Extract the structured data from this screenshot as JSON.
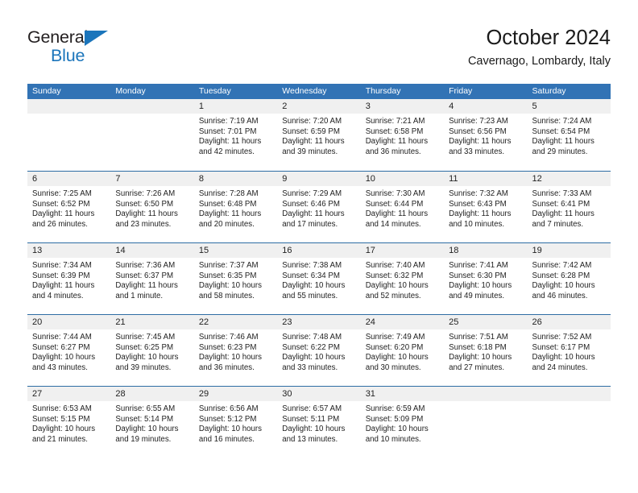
{
  "brand": {
    "name_part1": "General",
    "name_part2": "Blue",
    "color_dark": "#231f20",
    "color_blue": "#1b75bb"
  },
  "header": {
    "title": "October 2024",
    "location": "Cavernago, Lombardy, Italy"
  },
  "theme": {
    "header_blue": "#3273b5",
    "row_separator_blue": "#2e6da4",
    "day_strip_gray": "#f0f0f0",
    "text_color": "#222222"
  },
  "weekdays": [
    "Sunday",
    "Monday",
    "Tuesday",
    "Wednesday",
    "Thursday",
    "Friday",
    "Saturday"
  ],
  "weeks": [
    [
      {
        "day": "",
        "lines": []
      },
      {
        "day": "",
        "lines": []
      },
      {
        "day": "1",
        "lines": [
          "Sunrise: 7:19 AM",
          "Sunset: 7:01 PM",
          "Daylight: 11 hours",
          "and 42 minutes."
        ]
      },
      {
        "day": "2",
        "lines": [
          "Sunrise: 7:20 AM",
          "Sunset: 6:59 PM",
          "Daylight: 11 hours",
          "and 39 minutes."
        ]
      },
      {
        "day": "3",
        "lines": [
          "Sunrise: 7:21 AM",
          "Sunset: 6:58 PM",
          "Daylight: 11 hours",
          "and 36 minutes."
        ]
      },
      {
        "day": "4",
        "lines": [
          "Sunrise: 7:23 AM",
          "Sunset: 6:56 PM",
          "Daylight: 11 hours",
          "and 33 minutes."
        ]
      },
      {
        "day": "5",
        "lines": [
          "Sunrise: 7:24 AM",
          "Sunset: 6:54 PM",
          "Daylight: 11 hours",
          "and 29 minutes."
        ]
      }
    ],
    [
      {
        "day": "6",
        "lines": [
          "Sunrise: 7:25 AM",
          "Sunset: 6:52 PM",
          "Daylight: 11 hours",
          "and 26 minutes."
        ]
      },
      {
        "day": "7",
        "lines": [
          "Sunrise: 7:26 AM",
          "Sunset: 6:50 PM",
          "Daylight: 11 hours",
          "and 23 minutes."
        ]
      },
      {
        "day": "8",
        "lines": [
          "Sunrise: 7:28 AM",
          "Sunset: 6:48 PM",
          "Daylight: 11 hours",
          "and 20 minutes."
        ]
      },
      {
        "day": "9",
        "lines": [
          "Sunrise: 7:29 AM",
          "Sunset: 6:46 PM",
          "Daylight: 11 hours",
          "and 17 minutes."
        ]
      },
      {
        "day": "10",
        "lines": [
          "Sunrise: 7:30 AM",
          "Sunset: 6:44 PM",
          "Daylight: 11 hours",
          "and 14 minutes."
        ]
      },
      {
        "day": "11",
        "lines": [
          "Sunrise: 7:32 AM",
          "Sunset: 6:43 PM",
          "Daylight: 11 hours",
          "and 10 minutes."
        ]
      },
      {
        "day": "12",
        "lines": [
          "Sunrise: 7:33 AM",
          "Sunset: 6:41 PM",
          "Daylight: 11 hours",
          "and 7 minutes."
        ]
      }
    ],
    [
      {
        "day": "13",
        "lines": [
          "Sunrise: 7:34 AM",
          "Sunset: 6:39 PM",
          "Daylight: 11 hours",
          "and 4 minutes."
        ]
      },
      {
        "day": "14",
        "lines": [
          "Sunrise: 7:36 AM",
          "Sunset: 6:37 PM",
          "Daylight: 11 hours",
          "and 1 minute."
        ]
      },
      {
        "day": "15",
        "lines": [
          "Sunrise: 7:37 AM",
          "Sunset: 6:35 PM",
          "Daylight: 10 hours",
          "and 58 minutes."
        ]
      },
      {
        "day": "16",
        "lines": [
          "Sunrise: 7:38 AM",
          "Sunset: 6:34 PM",
          "Daylight: 10 hours",
          "and 55 minutes."
        ]
      },
      {
        "day": "17",
        "lines": [
          "Sunrise: 7:40 AM",
          "Sunset: 6:32 PM",
          "Daylight: 10 hours",
          "and 52 minutes."
        ]
      },
      {
        "day": "18",
        "lines": [
          "Sunrise: 7:41 AM",
          "Sunset: 6:30 PM",
          "Daylight: 10 hours",
          "and 49 minutes."
        ]
      },
      {
        "day": "19",
        "lines": [
          "Sunrise: 7:42 AM",
          "Sunset: 6:28 PM",
          "Daylight: 10 hours",
          "and 46 minutes."
        ]
      }
    ],
    [
      {
        "day": "20",
        "lines": [
          "Sunrise: 7:44 AM",
          "Sunset: 6:27 PM",
          "Daylight: 10 hours",
          "and 43 minutes."
        ]
      },
      {
        "day": "21",
        "lines": [
          "Sunrise: 7:45 AM",
          "Sunset: 6:25 PM",
          "Daylight: 10 hours",
          "and 39 minutes."
        ]
      },
      {
        "day": "22",
        "lines": [
          "Sunrise: 7:46 AM",
          "Sunset: 6:23 PM",
          "Daylight: 10 hours",
          "and 36 minutes."
        ]
      },
      {
        "day": "23",
        "lines": [
          "Sunrise: 7:48 AM",
          "Sunset: 6:22 PM",
          "Daylight: 10 hours",
          "and 33 minutes."
        ]
      },
      {
        "day": "24",
        "lines": [
          "Sunrise: 7:49 AM",
          "Sunset: 6:20 PM",
          "Daylight: 10 hours",
          "and 30 minutes."
        ]
      },
      {
        "day": "25",
        "lines": [
          "Sunrise: 7:51 AM",
          "Sunset: 6:18 PM",
          "Daylight: 10 hours",
          "and 27 minutes."
        ]
      },
      {
        "day": "26",
        "lines": [
          "Sunrise: 7:52 AM",
          "Sunset: 6:17 PM",
          "Daylight: 10 hours",
          "and 24 minutes."
        ]
      }
    ],
    [
      {
        "day": "27",
        "lines": [
          "Sunrise: 6:53 AM",
          "Sunset: 5:15 PM",
          "Daylight: 10 hours",
          "and 21 minutes."
        ]
      },
      {
        "day": "28",
        "lines": [
          "Sunrise: 6:55 AM",
          "Sunset: 5:14 PM",
          "Daylight: 10 hours",
          "and 19 minutes."
        ]
      },
      {
        "day": "29",
        "lines": [
          "Sunrise: 6:56 AM",
          "Sunset: 5:12 PM",
          "Daylight: 10 hours",
          "and 16 minutes."
        ]
      },
      {
        "day": "30",
        "lines": [
          "Sunrise: 6:57 AM",
          "Sunset: 5:11 PM",
          "Daylight: 10 hours",
          "and 13 minutes."
        ]
      },
      {
        "day": "31",
        "lines": [
          "Sunrise: 6:59 AM",
          "Sunset: 5:09 PM",
          "Daylight: 10 hours",
          "and 10 minutes."
        ]
      },
      {
        "day": "",
        "lines": []
      },
      {
        "day": "",
        "lines": []
      }
    ]
  ]
}
